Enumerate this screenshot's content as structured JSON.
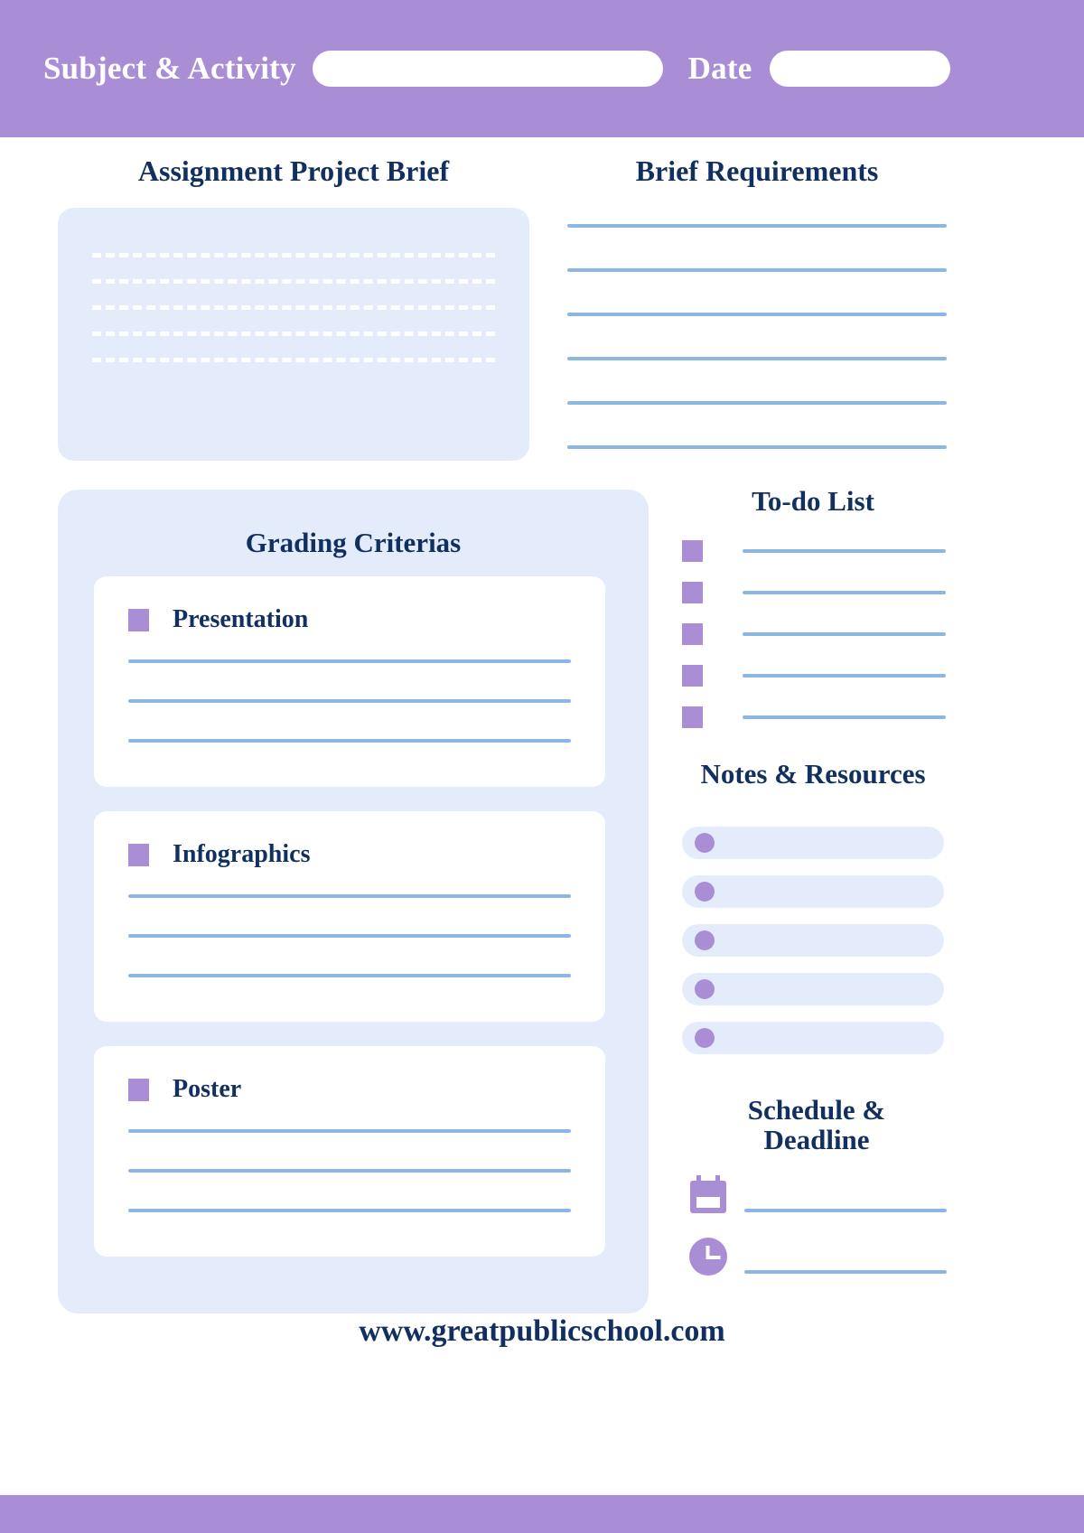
{
  "header": {
    "subject_label": "Subject & Activity",
    "subject_value": "",
    "subject_placeholder": "",
    "date_label": "Date",
    "date_value": "",
    "date_placeholder": ""
  },
  "sections": {
    "assignment_brief_title": "Assignment Project Brief",
    "brief_requirements_title": "Brief Requirements",
    "grading_criterias_title": "Grading Criterias",
    "todo_title": "To-do List",
    "notes_title": "Notes & Resources",
    "schedule_title_line1": "Schedule &",
    "schedule_title_line2": "Deadline"
  },
  "assignment_brief": {
    "dashed_line_count": 5
  },
  "brief_requirements": {
    "line_count": 6,
    "lines": [
      "",
      "",
      "",
      "",
      "",
      ""
    ]
  },
  "grading_criterias": {
    "cards": [
      {
        "label": "Presentation",
        "bullet": "square-bullet-icon",
        "rule_count": 3,
        "lines": [
          "",
          "",
          ""
        ]
      },
      {
        "label": "Infographics",
        "bullet": "square-bullet-icon",
        "rule_count": 3,
        "lines": [
          "",
          "",
          ""
        ]
      },
      {
        "label": "Poster",
        "bullet": "square-bullet-icon",
        "rule_count": 3,
        "lines": [
          "",
          "",
          ""
        ]
      }
    ]
  },
  "todo_list": {
    "item_count": 5,
    "items": [
      {
        "checked": false,
        "text": ""
      },
      {
        "checked": false,
        "text": ""
      },
      {
        "checked": false,
        "text": ""
      },
      {
        "checked": false,
        "text": ""
      },
      {
        "checked": false,
        "text": ""
      }
    ]
  },
  "notes_resources": {
    "item_count": 5,
    "items": [
      {
        "bullet": "circle-bullet-icon",
        "text": ""
      },
      {
        "bullet": "circle-bullet-icon",
        "text": ""
      },
      {
        "bullet": "circle-bullet-icon",
        "text": ""
      },
      {
        "bullet": "circle-bullet-icon",
        "text": ""
      },
      {
        "bullet": "circle-bullet-icon",
        "text": ""
      }
    ]
  },
  "schedule_deadline": {
    "rows": [
      {
        "icon": "calendar-icon",
        "value": ""
      },
      {
        "icon": "clock-icon",
        "value": ""
      }
    ]
  },
  "footer": {
    "website": "www.greatpublicschool.com"
  },
  "colors": {
    "brand_purple": "#a98ed6",
    "navy_text": "#12305f",
    "panel_blue": "#e4ecfb",
    "rule_blue": "#8cb7e2",
    "white": "#ffffff"
  }
}
